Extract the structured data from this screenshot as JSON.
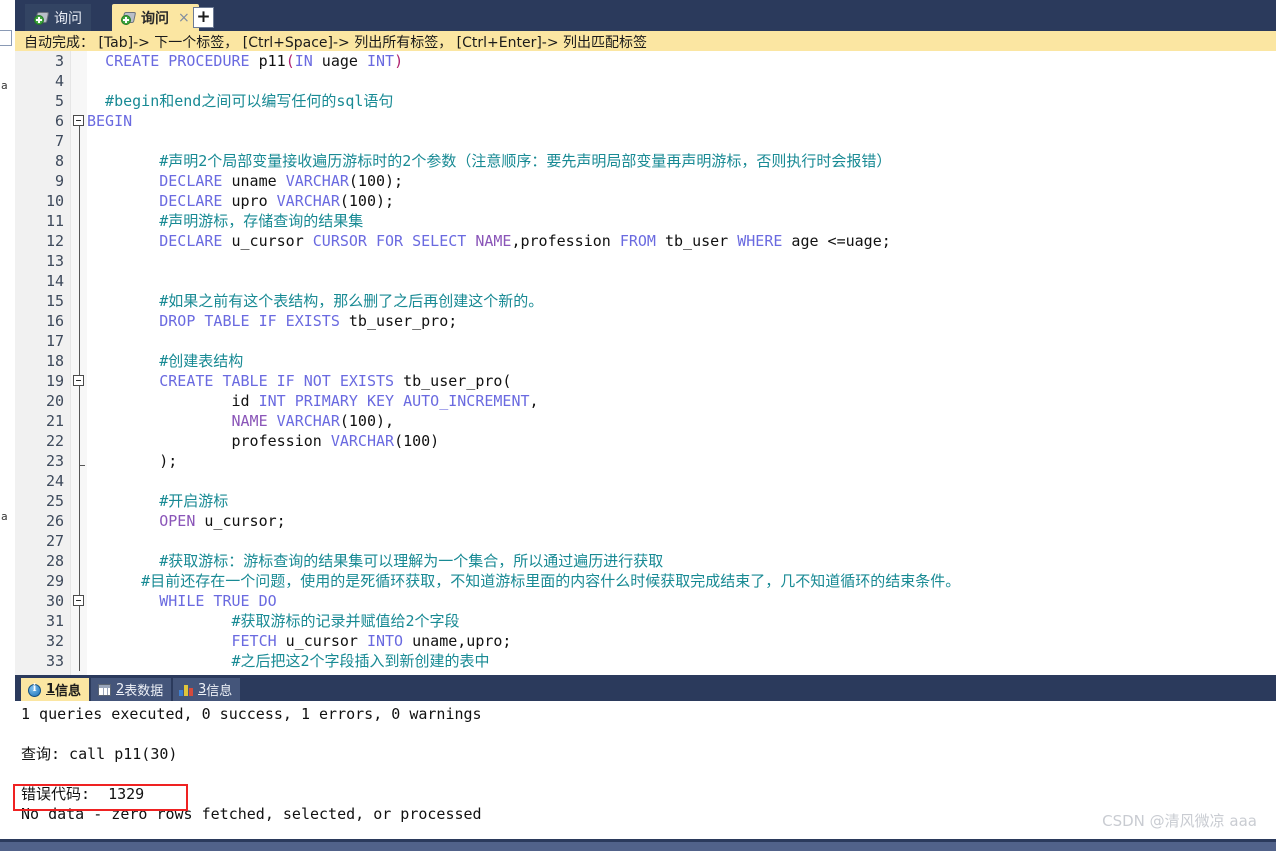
{
  "window": {
    "accent_yellow": "#fbe6a2",
    "accent_navy": "#2b3a5c",
    "error_red": "#ef2222"
  },
  "tabs": {
    "inactive": {
      "label": "询问",
      "icon": "query-icon"
    },
    "active": {
      "label": "询问",
      "icon": "query-icon",
      "close": "×"
    },
    "new_tab": "+"
  },
  "hint_bar": {
    "text": "自动完成： [Tab]-> 下一个标签， [Ctrl+Space]-> 列出所有标签， [Ctrl+Enter]-> 列出匹配标签"
  },
  "editor": {
    "first_line_number": 3,
    "last_line_number": 33,
    "line_numbers": [
      3,
      4,
      5,
      6,
      7,
      8,
      9,
      10,
      11,
      12,
      13,
      14,
      15,
      16,
      17,
      18,
      19,
      20,
      21,
      22,
      23,
      24,
      25,
      26,
      27,
      28,
      29,
      30,
      31,
      32,
      33
    ],
    "lines": [
      {
        "n": 3,
        "segments": [
          {
            "t": "  ",
            "c": "plain"
          },
          {
            "t": "CREATE PROCEDURE ",
            "c": "kw"
          },
          {
            "t": "p11",
            "c": "plain"
          },
          {
            "t": "(",
            "c": "pnc"
          },
          {
            "t": "IN",
            "c": "kw"
          },
          {
            "t": " uage ",
            "c": "plain"
          },
          {
            "t": "INT",
            "c": "kw"
          },
          {
            "t": ")",
            "c": "pnc"
          }
        ]
      },
      {
        "n": 4,
        "segments": []
      },
      {
        "n": 5,
        "segments": [
          {
            "t": "  #begin和end之间可以编写任何的sql语句",
            "c": "cmt"
          }
        ]
      },
      {
        "n": 6,
        "segments": [
          {
            "t": "BEGIN",
            "c": "kw"
          }
        ]
      },
      {
        "n": 7,
        "segments": []
      },
      {
        "n": 8,
        "segments": [
          {
            "t": "        #声明2个局部变量接收遍历游标时的2个参数（注意顺序：要先声明局部变量再声明游标，否则执行时会报错）",
            "c": "cmt"
          }
        ]
      },
      {
        "n": 9,
        "segments": [
          {
            "t": "        ",
            "c": "plain"
          },
          {
            "t": "DECLARE",
            "c": "kw"
          },
          {
            "t": " uname ",
            "c": "plain"
          },
          {
            "t": "VARCHAR",
            "c": "kw"
          },
          {
            "t": "(100);",
            "c": "plain"
          }
        ]
      },
      {
        "n": 10,
        "segments": [
          {
            "t": "        ",
            "c": "plain"
          },
          {
            "t": "DECLARE",
            "c": "kw"
          },
          {
            "t": " upro ",
            "c": "plain"
          },
          {
            "t": "VARCHAR",
            "c": "kw"
          },
          {
            "t": "(100);",
            "c": "plain"
          }
        ]
      },
      {
        "n": 11,
        "segments": [
          {
            "t": "        #声明游标，存储查询的结果集",
            "c": "cmt"
          }
        ]
      },
      {
        "n": 12,
        "segments": [
          {
            "t": "        ",
            "c": "plain"
          },
          {
            "t": "DECLARE",
            "c": "kw"
          },
          {
            "t": " u_cursor ",
            "c": "plain"
          },
          {
            "t": "CURSOR FOR SELECT ",
            "c": "kw"
          },
          {
            "t": "NAME",
            "c": "kw2"
          },
          {
            "t": ",profession ",
            "c": "plain"
          },
          {
            "t": "FROM",
            "c": "kw"
          },
          {
            "t": " tb_user ",
            "c": "plain"
          },
          {
            "t": "WHERE",
            "c": "kw"
          },
          {
            "t": " age <=uage;",
            "c": "plain"
          }
        ]
      },
      {
        "n": 13,
        "segments": []
      },
      {
        "n": 14,
        "segments": []
      },
      {
        "n": 15,
        "segments": [
          {
            "t": "        #如果之前有这个表结构，那么删了之后再创建这个新的。",
            "c": "cmt"
          }
        ]
      },
      {
        "n": 16,
        "segments": [
          {
            "t": "        ",
            "c": "plain"
          },
          {
            "t": "DROP TABLE IF EXISTS",
            "c": "kw"
          },
          {
            "t": " tb_user_pro;",
            "c": "plain"
          }
        ]
      },
      {
        "n": 17,
        "segments": []
      },
      {
        "n": 18,
        "segments": [
          {
            "t": "        #创建表结构",
            "c": "cmt"
          }
        ]
      },
      {
        "n": 19,
        "segments": [
          {
            "t": "        ",
            "c": "plain"
          },
          {
            "t": "CREATE TABLE IF NOT EXISTS",
            "c": "kw"
          },
          {
            "t": " tb_user_pro(",
            "c": "plain"
          }
        ]
      },
      {
        "n": 20,
        "segments": [
          {
            "t": "                id ",
            "c": "plain"
          },
          {
            "t": "INT PRIMARY KEY AUTO_INCREMENT",
            "c": "kw"
          },
          {
            "t": ",",
            "c": "plain"
          }
        ]
      },
      {
        "n": 21,
        "segments": [
          {
            "t": "                ",
            "c": "plain"
          },
          {
            "t": "NAME",
            "c": "kw2"
          },
          {
            "t": " ",
            "c": "plain"
          },
          {
            "t": "VARCHAR",
            "c": "kw"
          },
          {
            "t": "(100),",
            "c": "plain"
          }
        ]
      },
      {
        "n": 22,
        "segments": [
          {
            "t": "                profession ",
            "c": "plain"
          },
          {
            "t": "VARCHAR",
            "c": "kw"
          },
          {
            "t": "(100)",
            "c": "plain"
          }
        ]
      },
      {
        "n": 23,
        "segments": [
          {
            "t": "        );",
            "c": "plain"
          }
        ]
      },
      {
        "n": 24,
        "segments": []
      },
      {
        "n": 25,
        "segments": [
          {
            "t": "        #开启游标",
            "c": "cmt"
          }
        ]
      },
      {
        "n": 26,
        "segments": [
          {
            "t": "        ",
            "c": "plain"
          },
          {
            "t": "OPEN",
            "c": "kw2"
          },
          {
            "t": " u_cursor;",
            "c": "plain"
          }
        ]
      },
      {
        "n": 27,
        "segments": []
      },
      {
        "n": 28,
        "segments": [
          {
            "t": "        #获取游标：游标查询的结果集可以理解为一个集合，所以通过遍历进行获取",
            "c": "cmt"
          }
        ]
      },
      {
        "n": 29,
        "segments": [
          {
            "t": "      #目前还存在一个问题，使用的是死循环获取，不知道游标里面的内容什么时候获取完成结束了，几不知道循环的结束条件。",
            "c": "cmt"
          }
        ]
      },
      {
        "n": 30,
        "segments": [
          {
            "t": "        ",
            "c": "plain"
          },
          {
            "t": "WHILE TRUE DO",
            "c": "kw"
          }
        ]
      },
      {
        "n": 31,
        "segments": [
          {
            "t": "                #获取游标的记录并赋值给2个字段",
            "c": "cmt"
          }
        ]
      },
      {
        "n": 32,
        "segments": [
          {
            "t": "                ",
            "c": "plain"
          },
          {
            "t": "FETCH",
            "c": "kw"
          },
          {
            "t": " u_cursor ",
            "c": "plain"
          },
          {
            "t": "INTO",
            "c": "kw"
          },
          {
            "t": " uname,upro;",
            "c": "plain"
          }
        ]
      },
      {
        "n": 33,
        "segments": [
          {
            "t": "                #之后把这2个字段插入到新创建的表中",
            "c": "cmt"
          }
        ]
      }
    ],
    "fold_markers": [
      {
        "line": 6,
        "type": "collapse-box"
      },
      {
        "line": 19,
        "type": "collapse-box"
      },
      {
        "line": 23,
        "type": "end-tick"
      },
      {
        "line": 30,
        "type": "collapse-box"
      }
    ]
  },
  "results": {
    "tabs": [
      {
        "index": "1",
        "label": "信息",
        "icon": "info-icon",
        "active": true
      },
      {
        "index": "2",
        "label": "表数据",
        "icon": "grid-icon",
        "active": false
      },
      {
        "index": "3",
        "label": "信息",
        "icon": "chart-icon",
        "active": false
      }
    ],
    "output_lines": [
      "1 queries executed, 0 success, 1 errors, 0 warnings",
      "",
      "查询: call p11(30)",
      "",
      "错误代码:  1329",
      "No data - zero rows fetched, selected, or processed"
    ],
    "error_line_index": 4
  },
  "watermark": {
    "text": "CSDN @清风微凉 aaa"
  },
  "left_strip": {
    "fragments": [
      "a",
      "a"
    ]
  }
}
